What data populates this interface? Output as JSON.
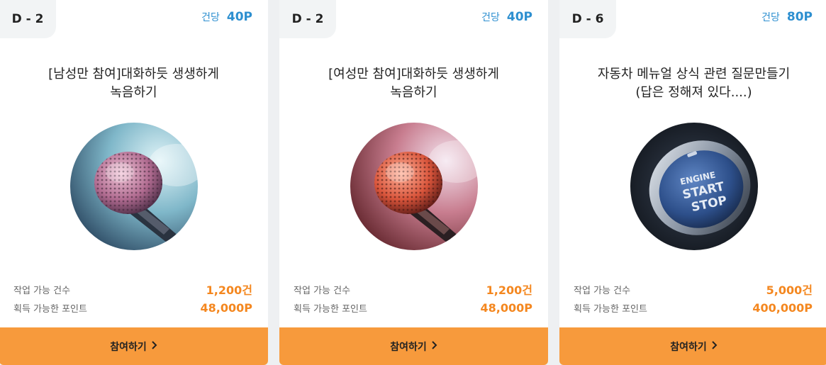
{
  "cards": [
    {
      "dday": "D - 2",
      "price_label": "건당",
      "price_value": "40P",
      "title_line1": "[남성만 참여]대화하듯 생생하게",
      "title_line2": "녹음하기",
      "image": "microphone-image",
      "count_label": "작업 가능 건수",
      "count_value": "1,200건",
      "points_label": "획득 가능한 포인트",
      "points_value": "48,000P",
      "join_label": "참여하기",
      "join_icon": "chevron-right-icon"
    },
    {
      "dday": "D - 2",
      "price_label": "건당",
      "price_value": "40P",
      "title_line1": "[여성만 참여]대화하듯 생생하게",
      "title_line2": "녹음하기",
      "image": "microphone-image",
      "count_label": "작업 가능 건수",
      "count_value": "1,200건",
      "points_label": "획득 가능한 포인트",
      "points_value": "48,000P",
      "join_label": "참여하기",
      "join_icon": "chevron-right-icon"
    },
    {
      "dday": "D - 6",
      "price_label": "건당",
      "price_value": "80P",
      "title_line1": "자동차 메뉴얼 상식 관련 질문만들기",
      "title_line2": "(답은 정해져 있다....)",
      "image": "engine-start-button-image",
      "button_text_1": "ENGINE",
      "button_text_2": "START",
      "button_text_3": "STOP",
      "count_label": "작업 가능 건수",
      "count_value": "5,000건",
      "points_label": "획득 가능한 포인트",
      "points_value": "400,000P",
      "join_label": "참여하기",
      "join_icon": "chevron-right-icon"
    }
  ],
  "colors": {
    "accent_orange": "#f79a3c",
    "value_orange": "#f4871f",
    "price_blue": "#2d8fd0"
  }
}
